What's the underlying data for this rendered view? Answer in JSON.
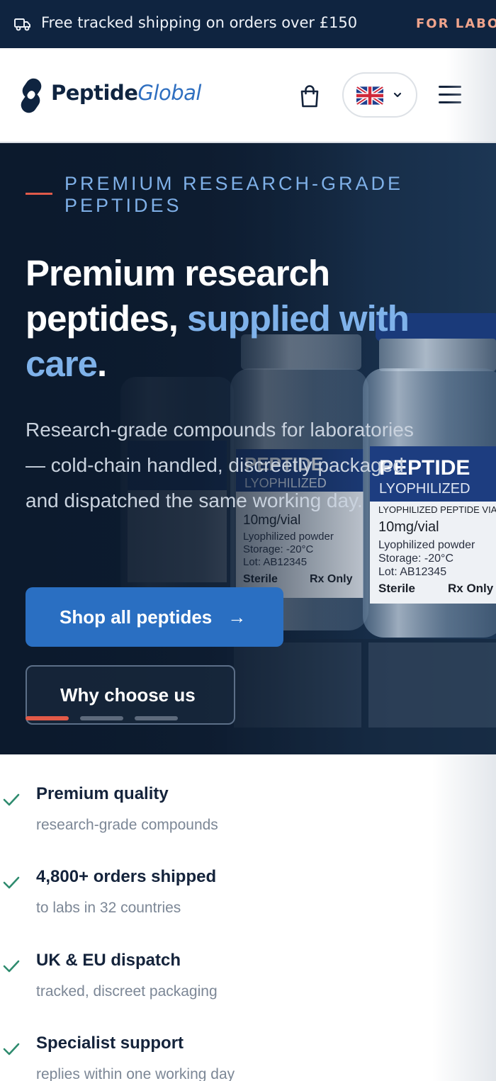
{
  "announcement": {
    "message": "Free tracked shipping on orders over £150",
    "secondary": "FOR LABOR"
  },
  "header": {
    "brand_primary": "Peptide",
    "brand_accent": "Global",
    "language_flag": "UK flag",
    "icons": [
      "truck-icon",
      "cart-icon",
      "chevron-down-icon",
      "menu-icon"
    ]
  },
  "hero": {
    "eyebrow": "PREMIUM RESEARCH-GRADE PEPTIDES",
    "headline_part1": "Premium research peptides, ",
    "headline_highlight": "supplied with care",
    "headline_end": ".",
    "subtitle": "Research-grade compounds for laboratories — cold-chain handled, discreetly packaged and dispatched the same working day.",
    "primary_cta": "Shop all peptides",
    "secondary_cta": "Why choose us",
    "slide_count": 3,
    "active_slide": 1,
    "vials": [
      {
        "brand": "PEPTIDE",
        "sub": "LYOPHILIZED",
        "line1": "LYOPHILIZED PEPTIDE VIAL",
        "dose": "10mg/vial",
        "form": "Lyophilized powder",
        "storage": "Storage: -20°C",
        "lot": "Lot: AB12345",
        "sterile": "Sterile",
        "rx": "Rx Only"
      }
    ]
  },
  "features": [
    {
      "title": "Premium quality",
      "desc": "research-grade compounds"
    },
    {
      "title": "4,800+ orders shipped",
      "desc": "to labs in 32 countries"
    },
    {
      "title": "UK & EU dispatch",
      "desc": "tracked, discreet packaging"
    },
    {
      "title": "Specialist support",
      "desc": "replies within one working day"
    }
  ],
  "colors": {
    "navy": "#0f2440",
    "accent_blue": "#2a6fc2",
    "highlight_blue": "#7fb2ea",
    "coral": "#e05a4a",
    "check_green": "#2e8b6e"
  }
}
